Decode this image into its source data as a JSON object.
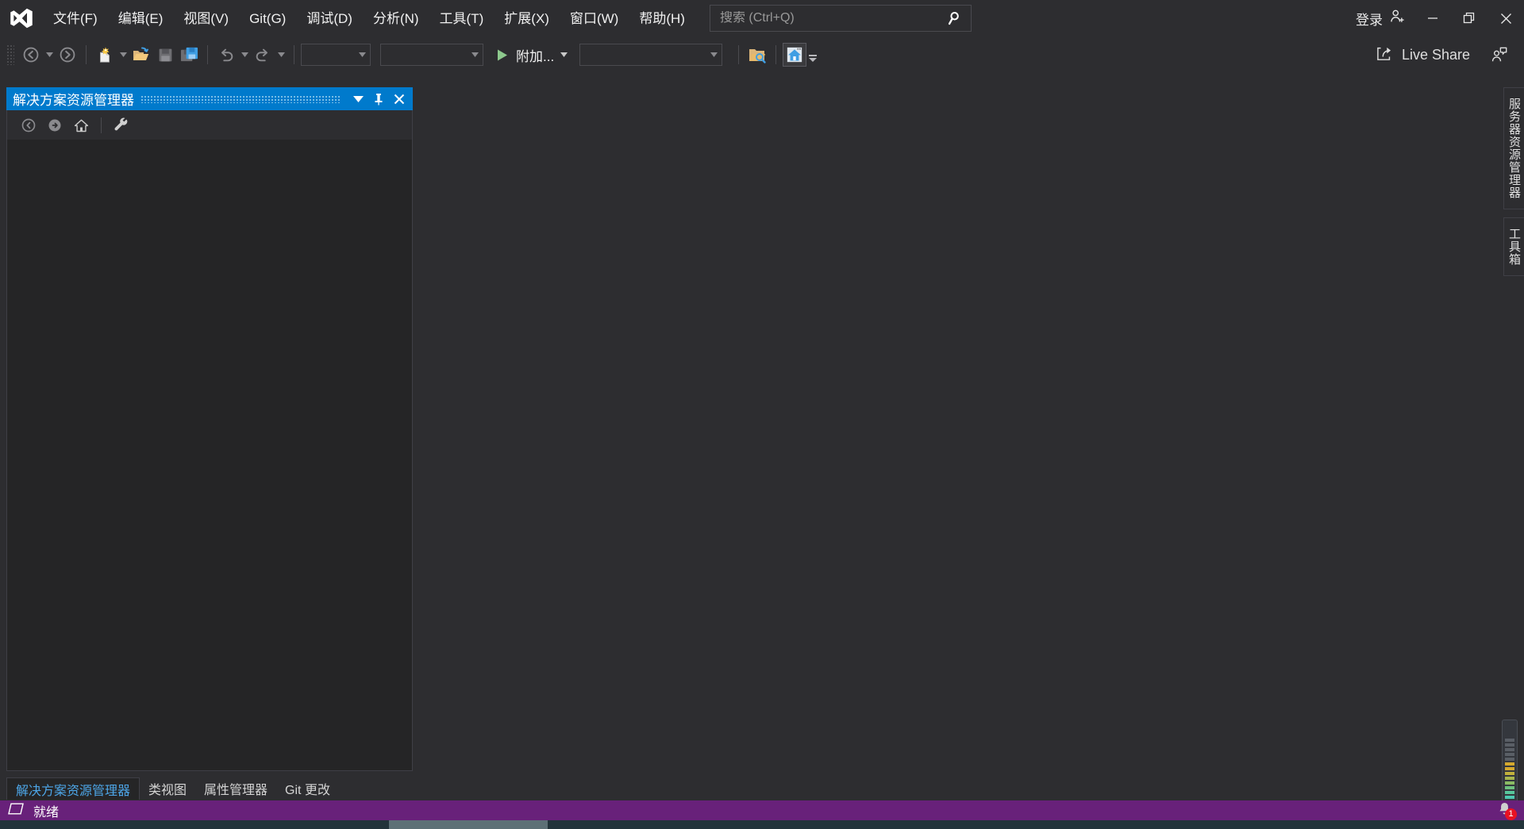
{
  "app": {
    "logo_icon": "visual-studio-logo"
  },
  "menu": {
    "items": [
      {
        "label": "文件(F)",
        "text": "文件",
        "mnemonic": "F"
      },
      {
        "label": "编辑(E)",
        "text": "编辑",
        "mnemonic": "E"
      },
      {
        "label": "视图(V)",
        "text": "视图",
        "mnemonic": "V"
      },
      {
        "label": "Git(G)",
        "text": "Git",
        "mnemonic": "G"
      },
      {
        "label": "调试(D)",
        "text": "调试",
        "mnemonic": "D"
      },
      {
        "label": "分析(N)",
        "text": "分析",
        "mnemonic": "N"
      },
      {
        "label": "工具(T)",
        "text": "工具",
        "mnemonic": "T"
      },
      {
        "label": "扩展(X)",
        "text": "扩展",
        "mnemonic": "X"
      },
      {
        "label": "窗口(W)",
        "text": "窗口",
        "mnemonic": "W"
      },
      {
        "label": "帮助(H)",
        "text": "帮助",
        "mnemonic": "H"
      }
    ]
  },
  "search": {
    "placeholder": "搜索 (Ctrl+Q)",
    "value": "",
    "icon": "search-icon"
  },
  "account": {
    "signin_label": "登录",
    "icon": "person-add-icon"
  },
  "window_controls": {
    "minimize": "minimize-icon",
    "restore": "restore-icon",
    "close": "close-icon"
  },
  "toolbar": {
    "grip": "drag-grip",
    "navigate_back": "navigate-back-icon",
    "navigate_forward": "navigate-forward-icon",
    "new_file": "new-file-icon",
    "open_file": "open-folder-icon",
    "save": "save-icon",
    "save_all": "save-all-icon",
    "undo": "undo-icon",
    "redo": "redo-icon",
    "combo_config": "",
    "combo_platform": "",
    "attach_label": "附加...",
    "attach_icon": "run-play-icon",
    "combo_target": "",
    "find_in_files": "folder-search-icon",
    "start_page": "home-start-page-icon",
    "overflow": "toolbar-overflow-icon",
    "live_share_label": "Live Share",
    "live_share_icon": "share-icon",
    "feedback_icon": "feedback-person-icon"
  },
  "solution_explorer": {
    "title": "解决方案资源管理器",
    "header_color": "#007acc",
    "dropdown_icon": "chevron-down-icon",
    "pin_icon": "pin-icon",
    "close_icon": "close-icon",
    "tools": {
      "back": "back-circle-icon",
      "forward": "forward-circle-icon",
      "home": "home-icon",
      "properties": "wrench-icon"
    },
    "content": ""
  },
  "dock_tabs": {
    "items": [
      {
        "label": "解决方案资源管理器",
        "active": true
      },
      {
        "label": "类视图",
        "active": false
      },
      {
        "label": "属性管理器",
        "active": false
      },
      {
        "label": "Git 更改",
        "active": false
      }
    ]
  },
  "right_tabs": {
    "items": [
      {
        "label": "服务器资源管理器"
      },
      {
        "label": "工具箱"
      }
    ]
  },
  "gauge": {
    "colors": [
      "#4ec9b0",
      "#4ec9b0",
      "#57c59a",
      "#6ec07e",
      "#8bbb63",
      "#a8b64e",
      "#c0b03c",
      "#d4a92f",
      "#d4a92f",
      "#5a5f66",
      "#5a5f66",
      "#5a5f66",
      "#5a5f66",
      "#5a5f66",
      "#5a5f66",
      "#5a5f66"
    ]
  },
  "status_bar": {
    "background": "#68217a",
    "ready_icon": "build-status-icon",
    "ready_text": "就绪",
    "notification_icon": "bell-icon",
    "notification_count": "1",
    "badge_color": "#e81123"
  }
}
